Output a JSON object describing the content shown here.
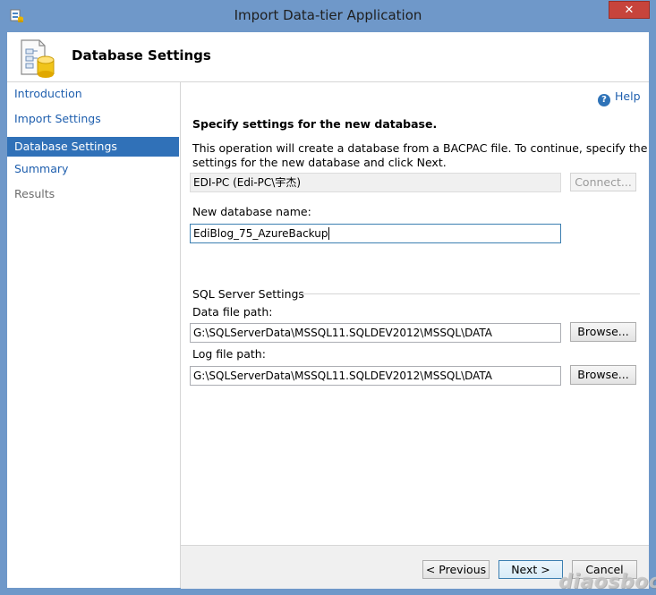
{
  "window": {
    "title": "Import Data-tier Application",
    "close_glyph": "✕"
  },
  "header": {
    "title": "Database Settings",
    "icon": "database-document-icon"
  },
  "sidebar": {
    "items": [
      {
        "label": "Introduction",
        "state": "link"
      },
      {
        "label": "Import Settings",
        "state": "link"
      },
      {
        "label": "Database Settings",
        "state": "active"
      },
      {
        "label": "Summary",
        "state": "link"
      },
      {
        "label": "Results",
        "state": "disabled"
      }
    ]
  },
  "main": {
    "help_label": "Help",
    "heading": "Specify settings for the new database.",
    "description_line1": "This operation will create a database from a BACPAC file. To continue, specify the",
    "description_line2": "settings for the new database and click Next.",
    "server_value": "EDI-PC (Edi-PC\\宇杰)",
    "connect_label": "Connect...",
    "db_name_label": "New database name:",
    "db_name_value": "EdiBlog_75_AzureBackup",
    "sql_group_label": "SQL Server Settings",
    "data_path_label": "Data file path:",
    "data_path_value": "G:\\SQLServerData\\MSSQL11.SQLDEV2012\\MSSQL\\DATA",
    "log_path_label": "Log file path:",
    "log_path_value": "G:\\SQLServerData\\MSSQL11.SQLDEV2012\\MSSQL\\DATA",
    "browse_label": "Browse..."
  },
  "footer": {
    "previous_label": "< Previous",
    "next_label": "Next >",
    "cancel_label": "Cancel"
  },
  "watermark": "diaosbook",
  "colors": {
    "frame": "#6f98c9",
    "close": "#c7443c",
    "active_nav": "#3071b8",
    "link": "#1f5fae"
  }
}
